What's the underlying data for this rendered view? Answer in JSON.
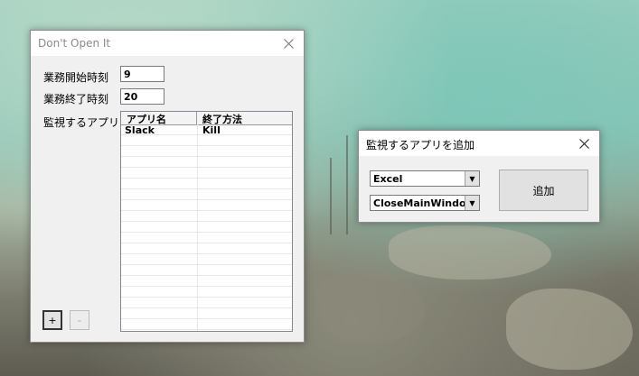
{
  "main_window": {
    "title": "Don't Open It",
    "start_time_label": "業務開始時刻",
    "start_time_value": "9",
    "end_time_label": "業務終了時刻",
    "end_time_value": "20",
    "apps_label": "監視するアプリ",
    "table": {
      "columns": [
        "アプリ名",
        "終了方法"
      ],
      "rows": [
        [
          "Slack",
          "Kill"
        ]
      ]
    },
    "add_button": "+",
    "remove_button": "-"
  },
  "add_window": {
    "title": "監視するアプリを追加",
    "app_select": "Excel",
    "method_select": "CloseMainWindow",
    "add_button": "追加"
  },
  "icons": {
    "close": "close-icon",
    "dropdown": "chevron-down-icon"
  }
}
